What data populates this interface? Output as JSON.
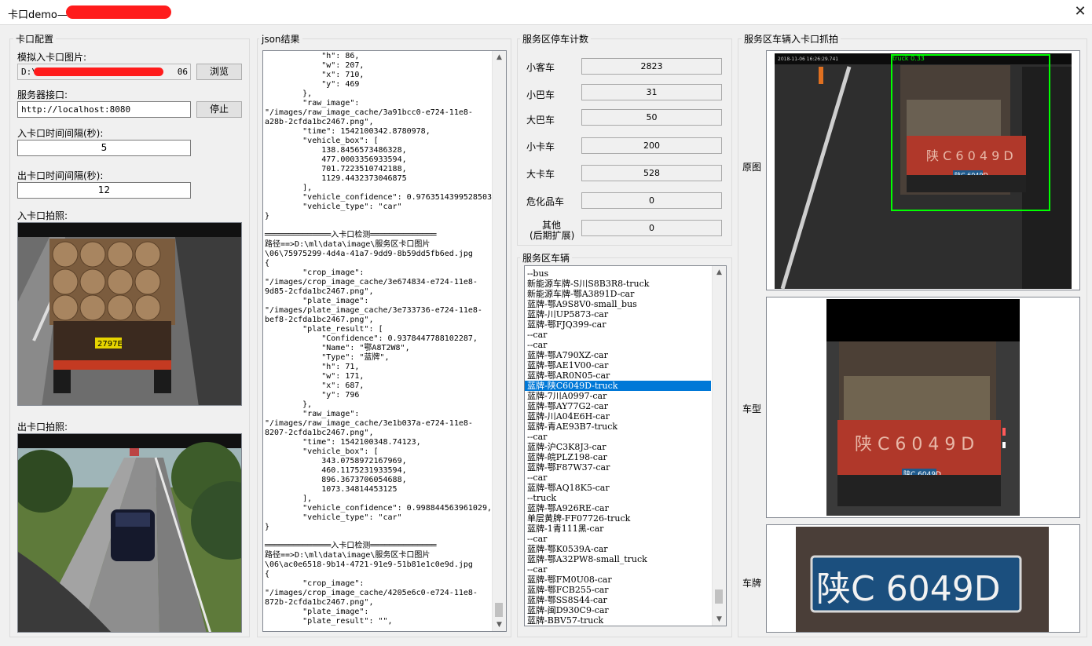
{
  "window": {
    "title": "卡口demo——",
    "close_glyph": "✕"
  },
  "config": {
    "group_label": "卡口配置",
    "sim_image_label": "模拟入卡口图片:",
    "sim_image_value": "D:\\",
    "sim_image_tail": "06",
    "browse_label": "浏览",
    "server_label": "服务器接口:",
    "server_value": "http://localhost:8080",
    "stop_label": "停止",
    "in_interval_label": "入卡口时间间隔(秒):",
    "in_interval_value": "5",
    "out_interval_label": "出卡口时间间隔(秒):",
    "out_interval_value": "12",
    "in_photo_label": "入卡口拍照:",
    "out_photo_label": "出卡口拍照:",
    "in_photo_plate": "2797E"
  },
  "json_panel": {
    "group_label": "json结果",
    "text": "            \"h\": 86,\n            \"w\": 207,\n            \"x\": 710,\n            \"y\": 469\n        },\n        \"raw_image\":\n\"/images/raw_image_cache/3a91bcc0-e724-11e8-\na28b-2cfda1bc2467.png\",\n        \"time\": 1542100342.8780978,\n        \"vehicle_box\": [\n            138.8456573486328,\n            477.0003356933594,\n            701.7223510742188,\n            1129.4432373046875\n        ],\n        \"vehicle_confidence\": 0.9763514399528503,\n        \"vehicle_type\": \"car\"\n}\n\n══════════════入卡口检测══════════════\n路径==>D:\\ml\\data\\image\\服务区卡口图片\n\\06\\75975299-4d4a-41a7-9dd9-8b59dd5fb6ed.jpg\n{\n        \"crop_image\":\n\"/images/crop_image_cache/3e674834-e724-11e8-\n9d85-2cfda1bc2467.png\",\n        \"plate_image\":\n\"/images/plate_image_cache/3e733736-e724-11e8-\nbef8-2cfda1bc2467.png\",\n        \"plate_result\": [\n            \"Confidence\": 0.9378447788102287,\n            \"Name\": \"鄂A8T2W8\",\n            \"Type\": \"蓝牌\",\n            \"h\": 71,\n            \"w\": 171,\n            \"x\": 687,\n            \"y\": 796\n        },\n        \"raw_image\":\n\"/images/raw_image_cache/3e1b037a-e724-11e8-\n8207-2cfda1bc2467.png\",\n        \"time\": 1542100348.74123,\n        \"vehicle_box\": [\n            343.0758972167969,\n            460.1175231933594,\n            896.3673706054688,\n            1073.34814453125\n        ],\n        \"vehicle_confidence\": 0.998844563961029,\n        \"vehicle_type\": \"car\"\n}\n\n══════════════入卡口检测══════════════\n路径==>D:\\ml\\data\\image\\服务区卡口图片\n\\06\\ac0e6518-9b14-4721-91e9-51b81e1c0e9d.jpg\n{\n        \"crop_image\":\n\"/images/crop_image_cache/4205e6c0-e724-11e8-\n872b-2cfda1bc2467.png\",\n        \"plate_image\":\n        \"plate_result\": \"\","
  },
  "parking": {
    "group_label": "服务区停车计数",
    "rows": [
      {
        "label": "小客车",
        "value": "2823"
      },
      {
        "label": "小巴车",
        "value": "31"
      },
      {
        "label": "大巴车",
        "value": "50"
      },
      {
        "label": "小卡车",
        "value": "200"
      },
      {
        "label": "大卡车",
        "value": "528"
      },
      {
        "label": "危化品车",
        "value": "0"
      },
      {
        "label": "其他",
        "label2": "(后期扩展)",
        "value": "0"
      }
    ]
  },
  "vehicles": {
    "group_label": "服务区车辆",
    "items": [
      "--bus",
      "新能源车牌-S川S8B3R8-truck",
      "新能源车牌-鄂A3891D-car",
      "蓝牌-鄂A9S8V0-small_bus",
      "蓝牌-川UP5873-car",
      "蓝牌-鄂FJQ399-car",
      "--car",
      "--car",
      "蓝牌-鄂A790XZ-car",
      "蓝牌-鄂AE1V00-car",
      "蓝牌-鄂AR0N05-car",
      "蓝牌-陕C6049D-truck",
      "蓝牌-7川A0997-car",
      "蓝牌-鄂AY77G2-car",
      "蓝牌-川A04E6H-car",
      "蓝牌-青AE93B7-truck",
      "--car",
      "蓝牌-沪C3K8J3-car",
      "蓝牌-皖PLZ198-car",
      "蓝牌-鄂F87W37-car",
      "--car",
      "蓝牌-鄂AQ18K5-car",
      "--truck",
      "蓝牌-鄂A926RE-car",
      "单层黄牌-FF07726-truck",
      "蓝牌-1青111黑-car",
      "--car",
      "蓝牌-鄂K0539A-car",
      "蓝牌-鄂A32PW8-small_truck",
      "--car",
      "蓝牌-鄂FM0U08-car",
      "蓝牌-鄂FCB255-car",
      "蓝牌-鄂SS8S44-car",
      "蓝牌-闽D930C9-car",
      "蓝牌-BBV57-truck"
    ],
    "selected_index": 11
  },
  "capture": {
    "group_label": "服务区车辆入卡口抓拍",
    "original_label": "原图",
    "type_label": "车型",
    "plate_label": "车牌",
    "detect_tag": "truck 0.33",
    "camera_stamp": "2018-11-06 16:26:29.741",
    "plate_text": "陕C 6049D",
    "plate_text_small": "陕C 6049D",
    "cargo_text": "陕 C 6 0 4 9 D"
  },
  "scroll": {
    "up": "▲",
    "down": "▼"
  },
  "colors": {
    "selection": "#0078d7",
    "detect_box": "#00ff00",
    "redaction": "#ff1c1c",
    "plate_blue": "#1f5a8c"
  }
}
